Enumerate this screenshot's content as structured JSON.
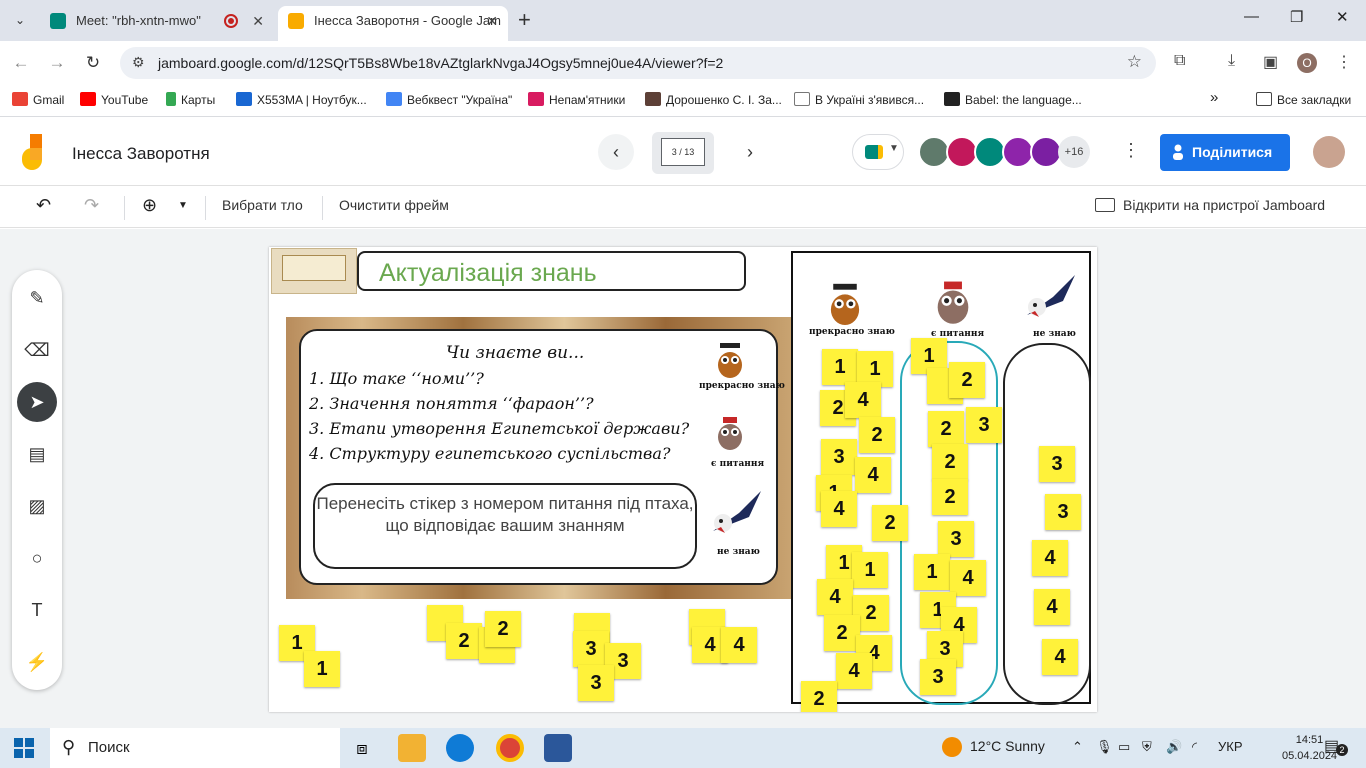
{
  "browser": {
    "tabs": [
      {
        "title": "Meet: \"rbh-xntn-mwo\"",
        "active": false
      },
      {
        "title": "Інесса Заворотня - Google Jam",
        "active": true
      }
    ],
    "new_tab": "+",
    "url": "jamboard.google.com/d/12SQrT5Bs8Wbe18vAZtglarkNvgaJ4Ogsy5mnej0ue4A/viewer?f=2",
    "profile_letter": "O",
    "bookmarks": [
      "Gmail",
      "YouTube",
      "Карты",
      "X553MA | Ноутбук...",
      "Вебквест \"Україна\"",
      "Непам'ятники",
      "Дорошенко С. І. За...",
      "В Україні з'явився...",
      "Babel: the language..."
    ],
    "bookmarks_more": "»",
    "all_bookmarks": "Все закладки"
  },
  "jamboard": {
    "title": "Інесса Заворотня",
    "frame_indicator": "3 / 13",
    "participants_more": "+16",
    "share_label": "Поділитися",
    "toolbar": {
      "background_label": "Вибрати тло",
      "clear_label": "Очистити фрейм",
      "open_device_label": "Відкрити на пристрої Jamboard"
    }
  },
  "frame": {
    "heading": "Актуалізація знань",
    "question_title": "Чи знаєте ви...",
    "questions": [
      "1. Що таке ‘‘номи’’?",
      "2. Значення поняття ‘‘фараон’’?",
      "3. Етапи утворення Египетської держави?",
      "4. Структуру египетського суспільства?"
    ],
    "instruction": "Перенесіть  стікер з номером питання під птаха, що відповідає вашим знанням",
    "bird_labels": [
      "прекрасно знаю",
      "є питання",
      "не знаю"
    ],
    "stickers": {
      "pool_row": [
        "1",
        "1",
        "2",
        "2",
        "2",
        "3",
        "3",
        "3",
        "4",
        "4"
      ],
      "column_know": [
        "1",
        "1",
        "2",
        "4",
        "2",
        "3",
        "4",
        "1",
        "4",
        "2",
        "1",
        "1",
        "4",
        "2",
        "2",
        "4",
        "4",
        "2"
      ],
      "column_questions": [
        "1",
        "1",
        "2",
        "2",
        "3",
        "2",
        "2",
        "3",
        "1",
        "4",
        "1",
        "4",
        "3",
        "3"
      ],
      "column_dont_know": [
        "3",
        "3",
        "4",
        "4",
        "4"
      ]
    }
  },
  "taskbar": {
    "search_placeholder": "Поиск",
    "weather": "12°C  Sunny",
    "language": "УКР",
    "time": "14:51",
    "date": "05.04.2024",
    "notifications": "2"
  }
}
